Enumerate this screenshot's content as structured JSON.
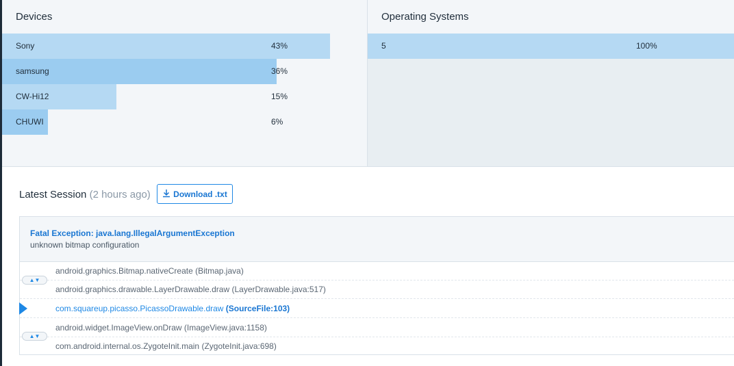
{
  "devices": {
    "title": "Devices",
    "items": [
      {
        "label": "Sony",
        "percent": "43%",
        "value": 0.43
      },
      {
        "label": "samsung",
        "percent": "36%",
        "value": 0.36
      },
      {
        "label": "CW-Hi12",
        "percent": "15%",
        "value": 0.15
      },
      {
        "label": "CHUWI",
        "percent": "6%",
        "value": 0.06
      }
    ]
  },
  "operating_systems": {
    "title": "Operating Systems",
    "items": [
      {
        "label": "5",
        "percent": "100%",
        "value": 1.0
      }
    ]
  },
  "session": {
    "title": "Latest Session",
    "time": "(2 hours ago)",
    "download_label": "Download .txt"
  },
  "exception": {
    "title": "Fatal Exception: java.lang.IllegalArgumentException",
    "message": "unknown bitmap configuration"
  },
  "frames": [
    {
      "method": "android.graphics.Bitmap.nativeCreate",
      "file": "(Bitmap.java)"
    },
    {
      "method": "android.graphics.drawable.LayerDrawable.draw",
      "file": "(LayerDrawable.java:517)"
    },
    {
      "method": "com.squareup.picasso.PicassoDrawable.draw",
      "file": "(SourceFile:103)"
    },
    {
      "method": "android.widget.ImageView.onDraw",
      "file": "(ImageView.java:1158)"
    },
    {
      "method": "com.android.internal.os.ZygoteInit.main",
      "file": "(ZygoteInit.java:698)"
    }
  ],
  "colors": {
    "bar_light": "#b5d9f3",
    "bar_dark": "#9bccf0",
    "accent": "#1e88e5"
  },
  "icons": {
    "download": "download-icon",
    "expand": "expand-frames-icon",
    "marker": "app-frame-marker-icon"
  }
}
